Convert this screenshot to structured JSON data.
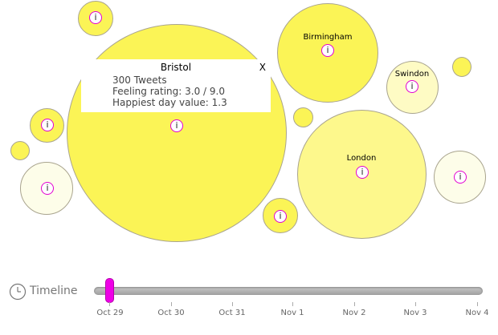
{
  "popup": {
    "title": "Bristol",
    "tweets": "300 Tweets",
    "feeling": "Feeling rating: 3.0 / 9.0",
    "happiest": "Happiest day value: 1.3",
    "close_label": "X"
  },
  "bubbles": {
    "birmingham": {
      "label": "Birmingham"
    },
    "swindon": {
      "label": "Swindon"
    },
    "london": {
      "label": "London"
    }
  },
  "info_icon_glyph": "i",
  "timeline": {
    "label": "Timeline",
    "ticks": [
      "Oct 29",
      "Oct 30",
      "Oct 31",
      "Nov 1",
      "Nov 2",
      "Nov 3",
      "Nov 4"
    ],
    "selected_day": "Oct 29"
  },
  "colors": {
    "bubble_strong": "#fbf456",
    "bubble_light": "#fefbc4",
    "info_ring": "#e200d2",
    "slider_handle": "#ee00e6"
  },
  "icons": {
    "timeline": "clock-icon",
    "info": "info-icon"
  }
}
